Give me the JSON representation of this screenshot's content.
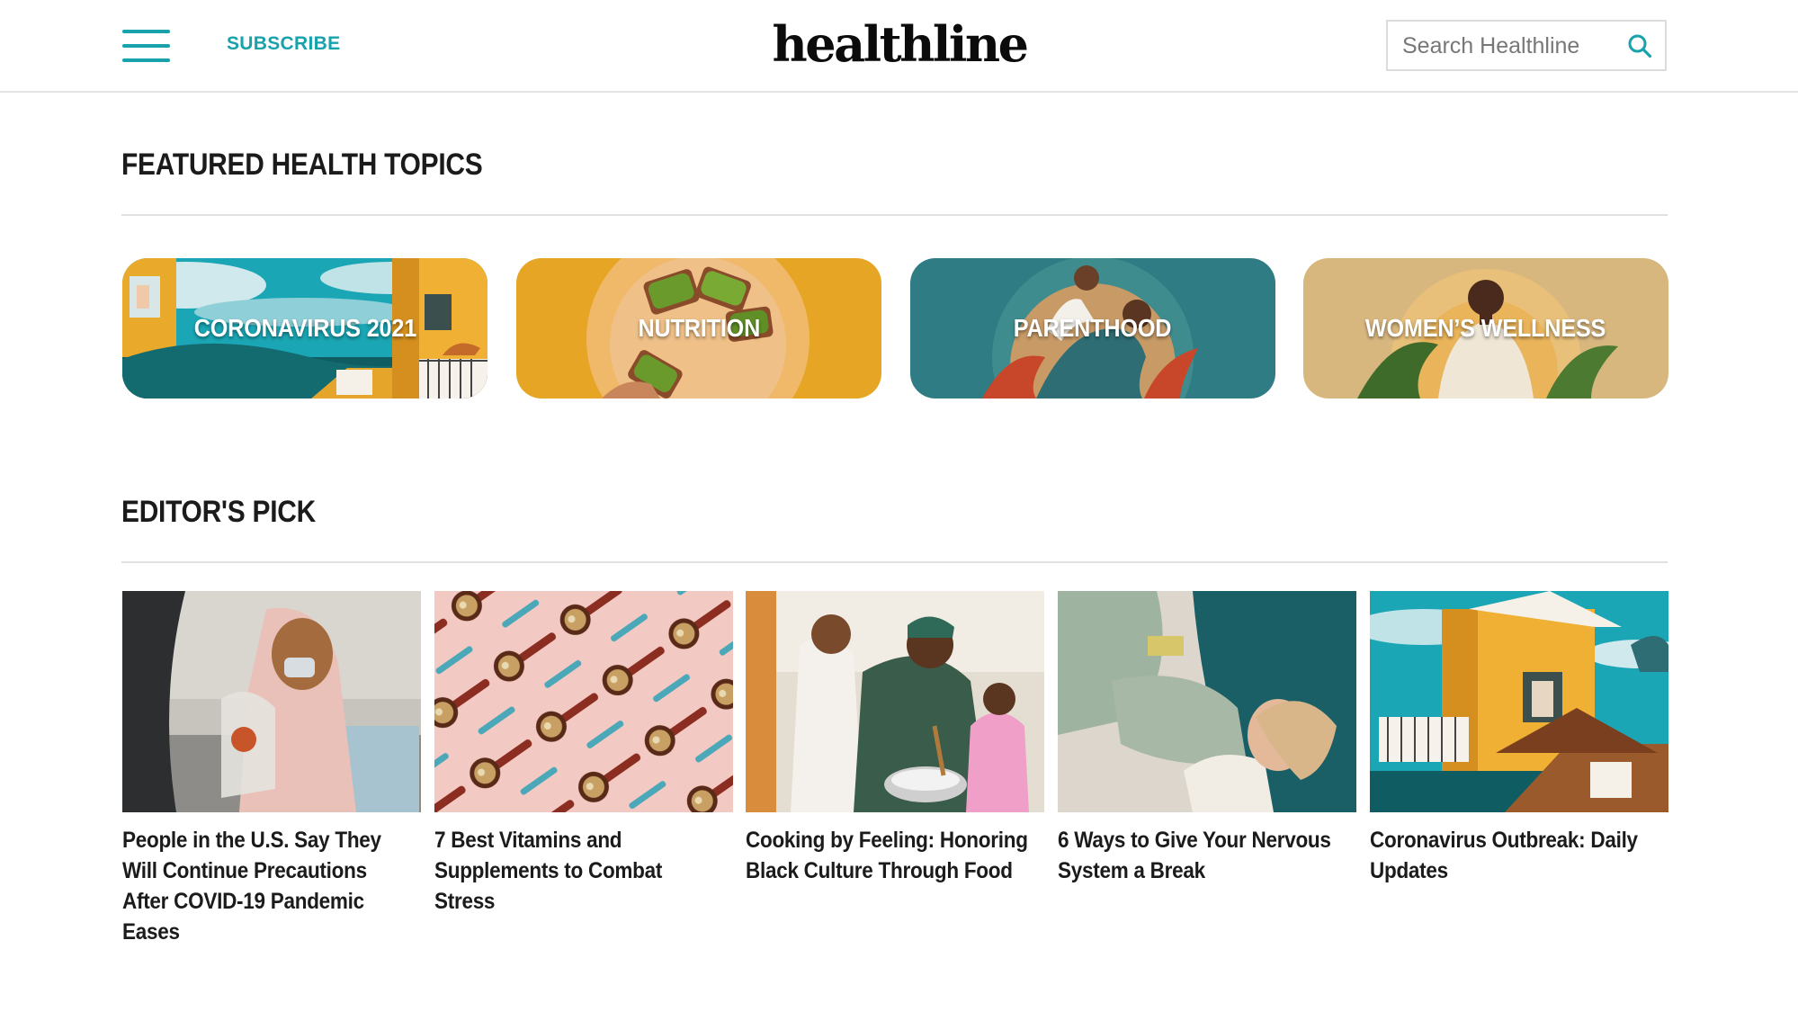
{
  "header": {
    "menu_icon": "hamburger-menu-icon",
    "subscribe_label": "SUBSCRIBE",
    "logo_text": "healthline",
    "search_placeholder": "Search Healthline",
    "search_icon": "search-icon",
    "accent_color": "#17a2ac"
  },
  "featured": {
    "title": "FEATURED HEALTH TOPICS",
    "topics": [
      {
        "label": "CORONAVIRUS 2021",
        "color": "#1aa6b4"
      },
      {
        "label": "NUTRITION",
        "color": "#e6a524"
      },
      {
        "label": "PARENTHOOD",
        "color": "#2f7c84"
      },
      {
        "label": "WOMEN’S WELLNESS",
        "color": "#d8b77f"
      }
    ]
  },
  "editors_pick": {
    "title": "EDITOR'S PICK",
    "articles": [
      {
        "headline": "People in the U.S. Say They Will Continue Precautions After COVID-19 Pandemic Eases"
      },
      {
        "headline": "7 Best Vitamins and Supplements to Combat Stress"
      },
      {
        "headline": "Cooking by Feeling: Honoring Black Culture Through Food"
      },
      {
        "headline": "6 Ways to Give Your Nervous System a Break"
      },
      {
        "headline": "Coronavirus Outbreak: Daily Updates"
      }
    ]
  }
}
